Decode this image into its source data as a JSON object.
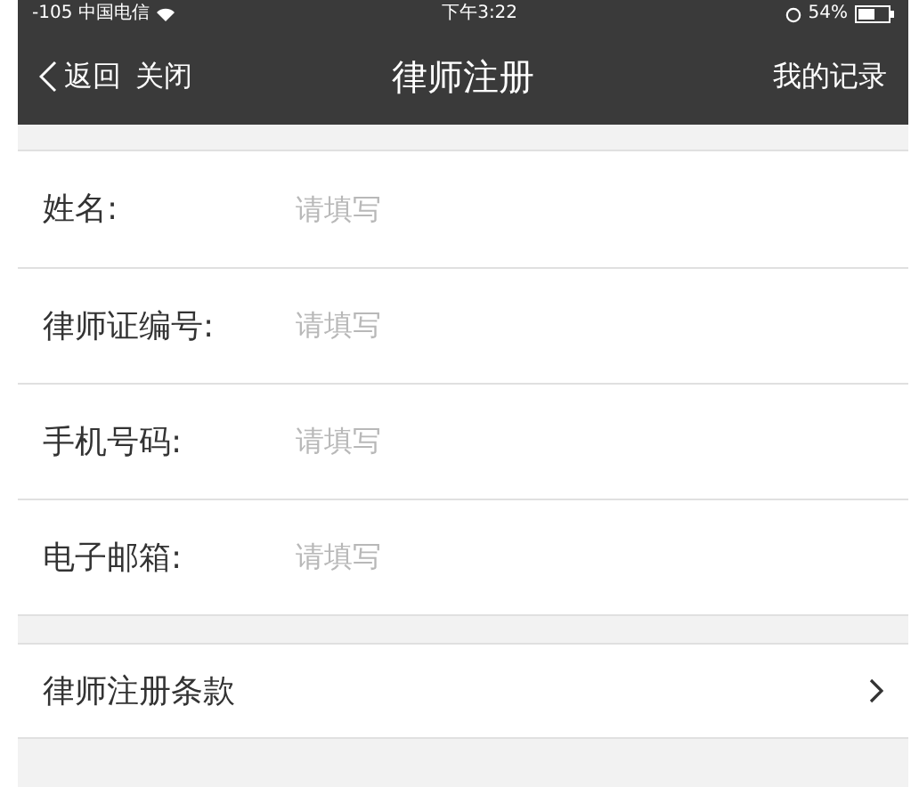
{
  "status_bar": {
    "carrier": "-105 中国电信",
    "time": "下午3:22",
    "battery": "54%"
  },
  "nav_bar": {
    "back": "返回",
    "close": "关闭",
    "title": "律师注册",
    "action": "我的记录"
  },
  "form_fields": [
    {
      "label": "姓名:",
      "placeholder": "请填写"
    },
    {
      "label": "律师证编号:",
      "placeholder": "请填写"
    },
    {
      "label": "手机号码:",
      "placeholder": "请填写"
    },
    {
      "label": "电子邮箱:",
      "placeholder": "请填写"
    }
  ],
  "terms_link": {
    "label": "律师注册条款"
  }
}
